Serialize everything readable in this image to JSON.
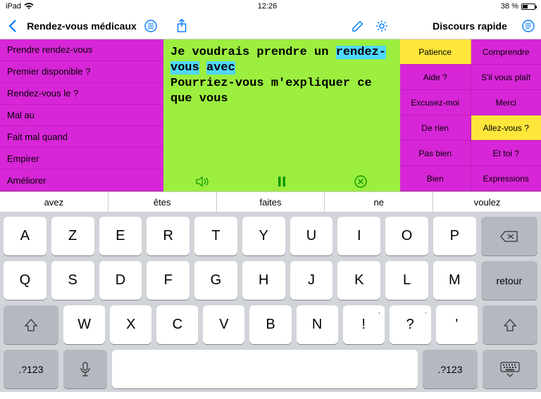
{
  "status": {
    "device": "iPad",
    "time": "12:26",
    "battery_pct": "38 %"
  },
  "header": {
    "left_title": "Rendez-vous médicaux",
    "right_title": "Discours rapide"
  },
  "left_items": [
    "Prendre rendez-vous",
    "Premier disponible ?",
    "Rendez-vous le ?",
    "Mal au",
    "Fait mal quand",
    "Empirer",
    "Améliorer"
  ],
  "compose": {
    "line1_pre": "Je voudrais prendre un ",
    "hl1": "rendez-vous",
    "mid": " ",
    "hl2": "avec",
    "line2": "Pourriez-vous m'expliquer ce que vous"
  },
  "right_grid": [
    [
      {
        "t": "Patience",
        "y": true
      },
      {
        "t": "Comprendre",
        "y": false
      }
    ],
    [
      {
        "t": "Aide ?",
        "y": false
      },
      {
        "t": "S'il vous plaît",
        "y": false
      }
    ],
    [
      {
        "t": "Excusez-moi",
        "y": false
      },
      {
        "t": "Merci",
        "y": false
      }
    ],
    [
      {
        "t": "De rien",
        "y": false
      },
      {
        "t": "Allez-vous ?",
        "y": true
      }
    ],
    [
      {
        "t": "Pas bien",
        "y": false
      },
      {
        "t": "Et toi ?",
        "y": false
      }
    ],
    [
      {
        "t": "Bien",
        "y": false
      },
      {
        "t": "Expressions",
        "y": false
      }
    ]
  ],
  "suggestions": [
    "avez",
    "êtes",
    "faites",
    "ne",
    "voulez"
  ],
  "keys": {
    "row1": [
      "A",
      "Z",
      "E",
      "R",
      "T",
      "Y",
      "U",
      "I",
      "O",
      "P"
    ],
    "row2": [
      "Q",
      "S",
      "D",
      "F",
      "G",
      "H",
      "J",
      "K",
      "L",
      "M"
    ],
    "row3": [
      "W",
      "X",
      "C",
      "V",
      "B",
      "N"
    ],
    "row3_punct": [
      {
        "m": "!",
        "s": ","
      },
      {
        "m": "?",
        "s": "."
      },
      {
        "m": "'",
        "s": ""
      }
    ],
    "return": "retour",
    "mode": ".?123"
  }
}
